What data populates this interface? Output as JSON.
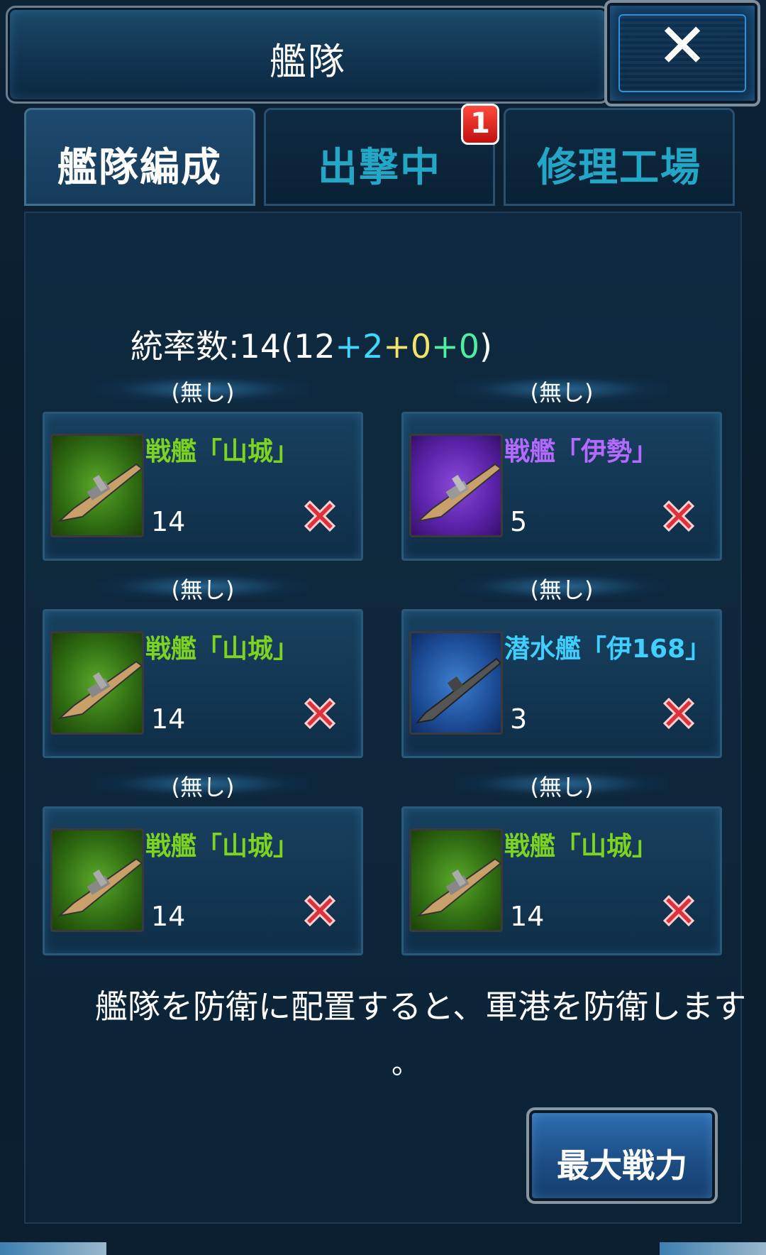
{
  "header": {
    "title": "艦隊",
    "close_glyph": "✕"
  },
  "tabs": [
    {
      "label": "艦隊編成",
      "active": true
    },
    {
      "label": "出撃中",
      "active": false,
      "badge": "1"
    },
    {
      "label": "修理工場",
      "active": false
    }
  ],
  "command": {
    "prefix": "統率数:14(",
    "base": "12",
    "plus1": "+2",
    "plus2": "+0",
    "plus3": "+0",
    "suffix": ")"
  },
  "slots": [
    {
      "label": "(無し)",
      "name": "戦艦「山城」",
      "level": "14",
      "color": "green"
    },
    {
      "label": "(無し)",
      "name": "戦艦「伊勢」",
      "level": "5",
      "color": "purple"
    },
    {
      "label": "(無し)",
      "name": "戦艦「山城」",
      "level": "14",
      "color": "green"
    },
    {
      "label": "(無し)",
      "name": "潜水艦「伊168」",
      "level": "3",
      "color": "blue"
    },
    {
      "label": "(無し)",
      "name": "戦艦「山城」",
      "level": "14",
      "color": "green"
    },
    {
      "label": "(無し)",
      "name": "戦艦「山城」",
      "level": "14",
      "color": "green"
    }
  ],
  "notice": {
    "line1": "艦隊を防衛に配置すると、軍港を防衛します",
    "line2": "。"
  },
  "max_button": {
    "label": "最大戦力"
  },
  "colors": {
    "green_name": "#7ed320",
    "purple_name": "#b56aff",
    "cyan_name": "#3fd0ff",
    "tab_inactive": "#22a7c7",
    "accent_blue": "#2f6fb0"
  }
}
